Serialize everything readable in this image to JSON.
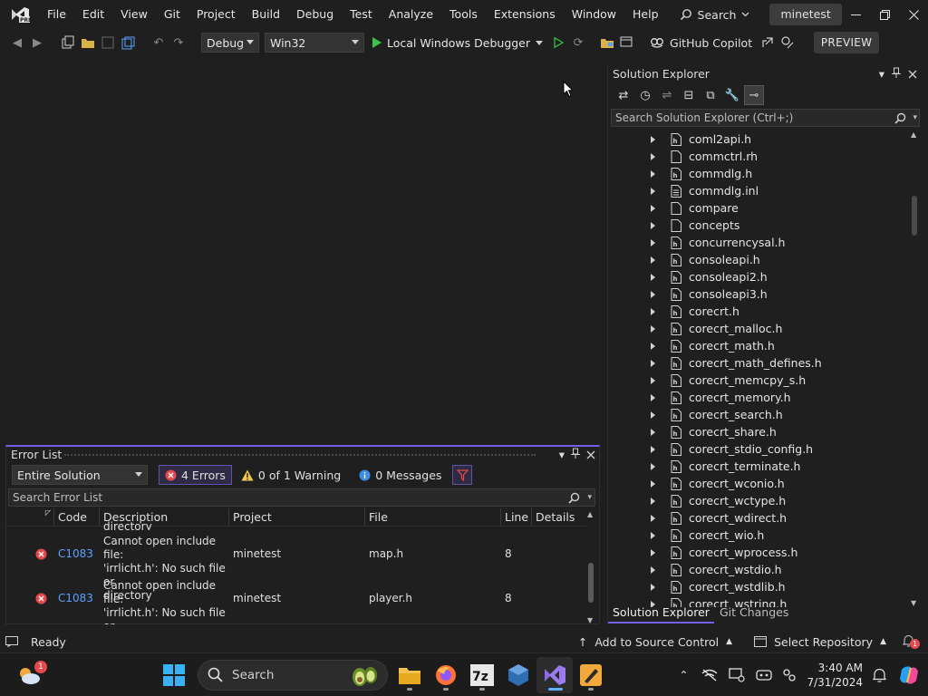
{
  "menu": [
    "File",
    "Edit",
    "View",
    "Git",
    "Project",
    "Build",
    "Debug",
    "Test",
    "Analyze",
    "Tools",
    "Extensions",
    "Window",
    "Help"
  ],
  "search_label": "Search",
  "project_name": "minetest",
  "toolbar": {
    "config": "Debug",
    "platform": "Win32",
    "run_label": "Local Windows Debugger",
    "copilot_label": "GitHub Copilot",
    "preview_label": "PREVIEW"
  },
  "solution_explorer": {
    "title": "Solution Explorer",
    "search_placeholder": "Search Solution Explorer (Ctrl+;)",
    "items": [
      {
        "name": "coml2api.h",
        "icon": "header-file-icon"
      },
      {
        "name": "commctrl.rh",
        "icon": "file-icon"
      },
      {
        "name": "commdlg.h",
        "icon": "header-file-icon"
      },
      {
        "name": "commdlg.inl",
        "icon": "text-file-icon"
      },
      {
        "name": "compare",
        "icon": "file-icon"
      },
      {
        "name": "concepts",
        "icon": "file-icon"
      },
      {
        "name": "concurrencysal.h",
        "icon": "header-file-icon"
      },
      {
        "name": "consoleapi.h",
        "icon": "header-file-icon"
      },
      {
        "name": "consoleapi2.h",
        "icon": "header-file-icon"
      },
      {
        "name": "consoleapi3.h",
        "icon": "header-file-icon"
      },
      {
        "name": "corecrt.h",
        "icon": "header-file-icon"
      },
      {
        "name": "corecrt_malloc.h",
        "icon": "header-file-icon"
      },
      {
        "name": "corecrt_math.h",
        "icon": "header-file-icon"
      },
      {
        "name": "corecrt_math_defines.h",
        "icon": "header-file-icon"
      },
      {
        "name": "corecrt_memcpy_s.h",
        "icon": "header-file-icon"
      },
      {
        "name": "corecrt_memory.h",
        "icon": "header-file-icon"
      },
      {
        "name": "corecrt_search.h",
        "icon": "header-file-icon"
      },
      {
        "name": "corecrt_share.h",
        "icon": "header-file-icon"
      },
      {
        "name": "corecrt_stdio_config.h",
        "icon": "header-file-icon"
      },
      {
        "name": "corecrt_terminate.h",
        "icon": "header-file-icon"
      },
      {
        "name": "corecrt_wconio.h",
        "icon": "header-file-icon"
      },
      {
        "name": "corecrt_wctype.h",
        "icon": "header-file-icon"
      },
      {
        "name": "corecrt_wdirect.h",
        "icon": "header-file-icon"
      },
      {
        "name": "corecrt_wio.h",
        "icon": "header-file-icon"
      },
      {
        "name": "corecrt_wprocess.h",
        "icon": "header-file-icon"
      },
      {
        "name": "corecrt_wstdio.h",
        "icon": "header-file-icon"
      },
      {
        "name": "corecrt_wstdlib.h",
        "icon": "header-file-icon"
      },
      {
        "name": "corecrt_wstring.h",
        "icon": "header-file-icon"
      }
    ],
    "tabs": [
      "Solution Explorer",
      "Git Changes"
    ]
  },
  "error_list": {
    "title": "Error List",
    "scope": "Entire Solution",
    "errors_label": "4 Errors",
    "warnings_label": "0 of 1 Warning",
    "messages_label": "0 Messages",
    "search_placeholder": "Search Error List",
    "columns": [
      "Code",
      "Description",
      "Project",
      "File",
      "Line",
      "Details"
    ],
    "partial_text": "directory",
    "rows": [
      {
        "code": "C1083",
        "desc1": "Cannot open include file:",
        "desc2": "'irrlicht.h': No such file or",
        "desc3": "directory",
        "project": "minetest",
        "file": "map.h",
        "line": "8"
      },
      {
        "code": "C1083",
        "desc1": "Cannot open include file:",
        "desc2": "'irrlicht.h': No such file or",
        "desc3": "directory",
        "project": "minetest",
        "file": "player.h",
        "line": "8"
      }
    ]
  },
  "status": {
    "ready": "Ready",
    "source_control": "Add to Source Control",
    "repository": "Select Repository",
    "notification_count": "1"
  },
  "taskbar": {
    "search_label": "Search",
    "weather_badge": "1",
    "time": "3:40 AM",
    "date": "7/31/2024"
  },
  "colors": {
    "accent": "#7160e8",
    "error": "#e5484d",
    "warning": "#f2c94c",
    "info": "#3a8ee6",
    "run": "#3ac44a",
    "link": "#5aa0ff"
  }
}
